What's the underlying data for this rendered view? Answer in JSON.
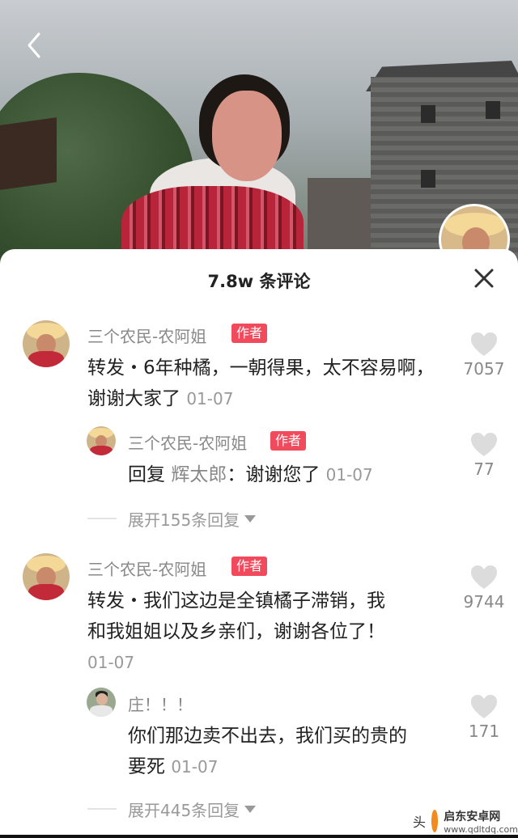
{
  "header": {
    "back_icon": "chevron-left-icon"
  },
  "sheet": {
    "title": "7.8w 条评论",
    "close_icon": "close-icon"
  },
  "comments": [
    {
      "user": "三个农民-农阿姐",
      "badge": "作者",
      "prefix": "转发・",
      "text": "6年种橘，一朝得果，太不容易啊，谢谢大家了",
      "time": "01-07",
      "likes": "7057",
      "replies": [
        {
          "user": "三个农民-农阿姐",
          "badge": "作者",
          "reply_word": "回复",
          "reply_to": "辉太郎",
          "text": "：谢谢您了",
          "time": "01-07",
          "likes": "77"
        }
      ],
      "expand_label": "展开155条回复"
    },
    {
      "user": "三个农民-农阿姐",
      "badge": "作者",
      "prefix": "转发・",
      "text_line1": "我们这边是全镇橘子滞销，我",
      "text_line2": "和我姐姐以及乡亲们，谢谢各位了！",
      "time": "01-07",
      "likes": "9744",
      "replies": [
        {
          "user": "庄！！！",
          "text_line1": "你们那边卖不出去，我们买的贵的",
          "text_line2": "要死",
          "time": "01-07",
          "likes": "171"
        }
      ],
      "expand_label": "展开445条回复"
    }
  ],
  "watermark": {
    "name": "启东安卓网",
    "url": "www.qdltdq.com",
    "left_char": "头"
  }
}
